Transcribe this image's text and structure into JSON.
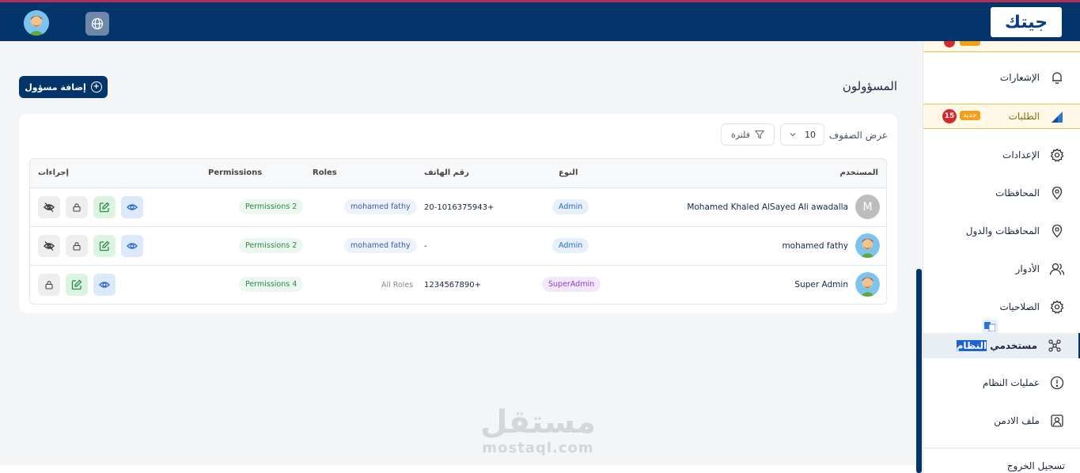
{
  "topbar": {
    "logo_text": "جيتك",
    "globe_icon": "globe-icon",
    "avatar_icon": "user-avatar"
  },
  "sidebar": {
    "items": [
      {
        "label": "الإشعارات",
        "icon": "bell-icon"
      },
      {
        "label": "الطلبات",
        "icon": "orders-icon",
        "badge_new": "جديد",
        "badge_count": "15"
      },
      {
        "label": "الإعدادات",
        "icon": "gear-icon"
      },
      {
        "label": "المحافظات",
        "icon": "location-icon"
      },
      {
        "label": "المحافظات والدول",
        "icon": "location-icon"
      },
      {
        "label": "الأدوار",
        "icon": "users-icon"
      },
      {
        "label": "الصلاحيات",
        "icon": "gear-icon"
      },
      {
        "label_pre": "مستخدمي ",
        "label_hl": "النظام",
        "icon": "network-icon"
      },
      {
        "label": "عمليات النظام",
        "icon": "alert-circle-icon"
      },
      {
        "label": "ملف الادمن",
        "icon": "profile-icon"
      }
    ],
    "logout_label": "تسجيل الخروج"
  },
  "main": {
    "title": "المسؤولون",
    "add_button": "إضافة مسؤول",
    "rows_label": "عرض الصفوف",
    "rows_value": "10",
    "filter_label": "فلترة"
  },
  "table": {
    "headers": {
      "user": "المستخدم",
      "type": "النوع",
      "phone": "رقم الهاتف",
      "roles": "Roles",
      "permissions": "Permissions",
      "actions": "إجراءات"
    },
    "rows": [
      {
        "name": "Mohamed Khaled AlSayed Ali awadalla",
        "avatar_letter": "M",
        "type": "Admin",
        "phone": "20-1016375943+",
        "role": "mohamed fathy",
        "permissions": "Permissions 2"
      },
      {
        "name": "mohamed fathy",
        "type": "Admin",
        "phone": "-",
        "role": "mohamed fathy",
        "permissions": "Permissions 2"
      },
      {
        "name": "Super Admin",
        "type": "SuperAdmin",
        "phone": "1234567890+",
        "role": "All Roles",
        "permissions": "Permissions 4"
      }
    ]
  },
  "watermark": {
    "arabic": "مستقل",
    "latin": "mostaql.com"
  }
}
